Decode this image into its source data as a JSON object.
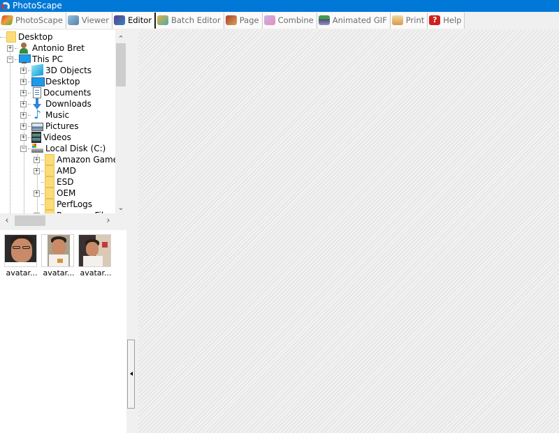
{
  "window": {
    "title": "PhotoScape",
    "app_icon": "photoscape-logo-icon"
  },
  "tabs": [
    {
      "label": "PhotoScape",
      "icon": "photoscape-icon",
      "active": false
    },
    {
      "label": "Viewer",
      "icon": "viewer-icon",
      "active": false
    },
    {
      "label": "Editor",
      "icon": "editor-icon",
      "active": true
    },
    {
      "label": "Batch Editor",
      "icon": "batch-editor-icon",
      "active": false
    },
    {
      "label": "Page",
      "icon": "page-icon",
      "active": false
    },
    {
      "label": "Combine",
      "icon": "combine-icon",
      "active": false
    },
    {
      "label": "Animated GIF",
      "icon": "animated-gif-icon",
      "active": false
    },
    {
      "label": "Print",
      "icon": "print-icon",
      "active": false
    },
    {
      "label": "Help",
      "icon": "help-icon",
      "active": false
    }
  ],
  "tree": {
    "nodes": [
      {
        "label": "Desktop",
        "icon": "folder-icon",
        "expander": "none"
      },
      {
        "label": "Antonio Bret",
        "icon": "user-icon",
        "expander": "plus"
      },
      {
        "label": "This PC",
        "icon": "computer-icon",
        "expander": "minus"
      },
      {
        "label": "3D Objects",
        "icon": "3d-objects-icon",
        "expander": "plus"
      },
      {
        "label": "Desktop",
        "icon": "desktop-icon",
        "expander": "plus"
      },
      {
        "label": "Documents",
        "icon": "documents-icon",
        "expander": "plus"
      },
      {
        "label": "Downloads",
        "icon": "downloads-icon",
        "expander": "plus"
      },
      {
        "label": "Music",
        "icon": "music-icon",
        "expander": "plus"
      },
      {
        "label": "Pictures",
        "icon": "pictures-icon",
        "expander": "plus"
      },
      {
        "label": "Videos",
        "icon": "videos-icon",
        "expander": "plus"
      },
      {
        "label": "Local Disk (C:)",
        "icon": "local-disk-icon",
        "expander": "minus"
      },
      {
        "label": "Amazon Games",
        "icon": "folder-icon",
        "expander": "plus"
      },
      {
        "label": "AMD",
        "icon": "folder-icon",
        "expander": "plus"
      },
      {
        "label": "ESD",
        "icon": "folder-icon",
        "expander": "none"
      },
      {
        "label": "OEM",
        "icon": "folder-icon",
        "expander": "plus"
      },
      {
        "label": "PerfLogs",
        "icon": "folder-icon",
        "expander": "none"
      },
      {
        "label": "Program Files",
        "icon": "folder-icon",
        "expander": "plus"
      }
    ]
  },
  "thumbnails": [
    {
      "caption": "avatar..."
    },
    {
      "caption": "avatar..."
    },
    {
      "caption": "avatar..."
    }
  ],
  "scrollbar_glyphs": {
    "up": "⌃",
    "down": "⌄",
    "left": "‹",
    "right": "›"
  },
  "help_glyph": "?",
  "music_glyph": "♪"
}
